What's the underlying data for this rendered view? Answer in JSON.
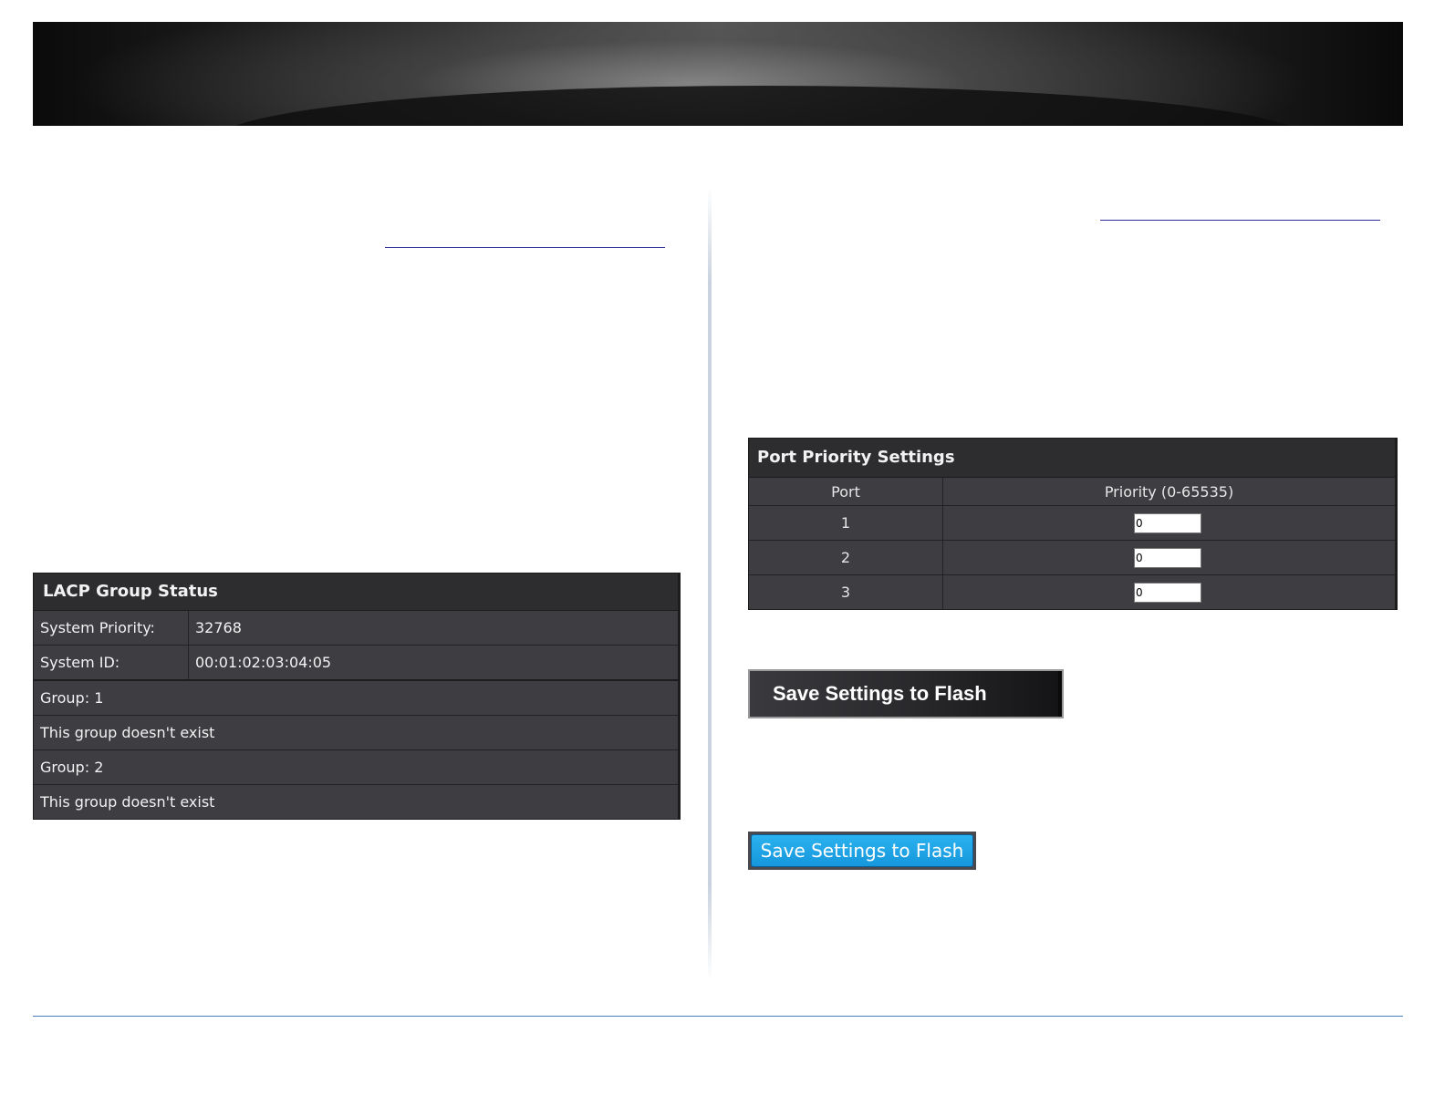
{
  "lacp_group_status": {
    "title": "LACP Group Status",
    "system_priority_label": "System Priority:",
    "system_priority_value": "32768",
    "system_id_label": "System ID:",
    "system_id_value": "00:01:02:03:04:05",
    "groups": [
      {
        "label": "Group: 1",
        "status": "This group doesn't exist"
      },
      {
        "label": "Group: 2",
        "status": "This group doesn't exist"
      }
    ]
  },
  "port_priority_settings": {
    "title": "Port Priority Settings",
    "col_port": "Port",
    "col_priority": "Priority (0-65535)",
    "rows": [
      {
        "port": "1",
        "priority": "0"
      },
      {
        "port": "2",
        "priority": "0"
      },
      {
        "port": "3",
        "priority": "0"
      }
    ]
  },
  "buttons": {
    "save_flash_dark": "Save Settings to Flash",
    "save_flash_blue": "Save Settings to Flash"
  }
}
